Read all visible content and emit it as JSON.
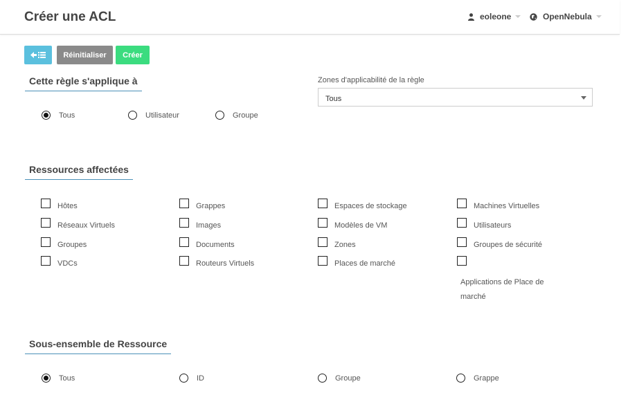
{
  "header": {
    "title": "Créer une ACL",
    "user": "eoleone",
    "zone": "OpenNebula"
  },
  "toolbar": {
    "back_icon": "back-list-icon",
    "reset_label": "Réinitialiser",
    "create_label": "Créer"
  },
  "applies_to": {
    "title": "Cette règle s'applique à",
    "options": [
      "Tous",
      "Utilisateur",
      "Groupe"
    ],
    "selected": "Tous"
  },
  "zones": {
    "label": "Zones d'applicabilité de la règle",
    "selected": "Tous"
  },
  "resources": {
    "title": "Ressources affectées",
    "items": [
      "Hôtes",
      "Grappes",
      "Espaces de stockage",
      "Machines Virtuelles",
      "Réseaux Virtuels",
      "Images",
      "Modèles de VM",
      "Utilisateurs",
      "Groupes",
      "Documents",
      "Zones",
      "Groupes de sécurité",
      "VDCs",
      "Routeurs Virtuels",
      "Places de marché",
      "Applications de Place de marché"
    ]
  },
  "subset": {
    "title": "Sous-ensemble de Ressource",
    "options": [
      "Tous",
      "ID",
      "Groupe",
      "Grappe"
    ],
    "selected": "Tous"
  },
  "colors": {
    "accent_blue": "#5bc0de",
    "reset_grey": "#8a8a8a",
    "create_green": "#3bdc7f",
    "underline_blue": "#4a90b8"
  }
}
